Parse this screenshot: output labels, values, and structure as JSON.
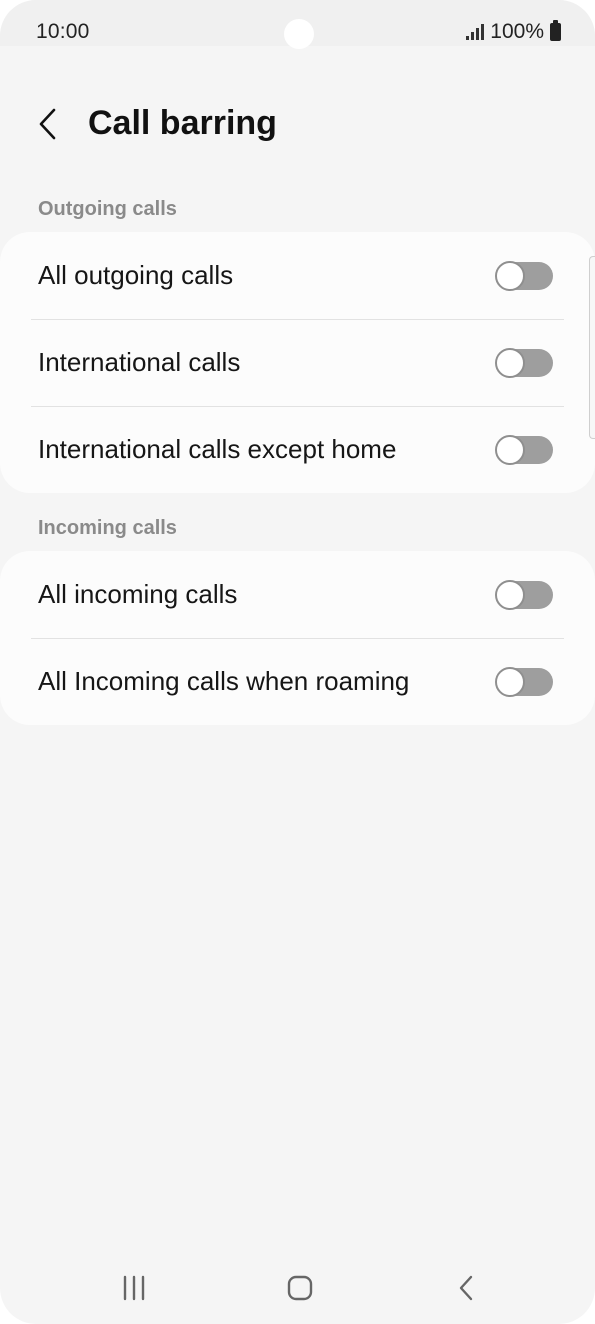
{
  "status_bar": {
    "time": "10:00",
    "battery": "100%",
    "icons": [
      "signal-icon",
      "battery-icon"
    ]
  },
  "header": {
    "title": "Call barring",
    "back_icon": "chevron-left-icon"
  },
  "sections": [
    {
      "title": "Outgoing calls",
      "items": [
        {
          "label": "All outgoing calls",
          "enabled": false
        },
        {
          "label": "International calls",
          "enabled": false
        },
        {
          "label": "International calls except home",
          "enabled": false
        }
      ]
    },
    {
      "title": "Incoming calls",
      "items": [
        {
          "label": "All incoming calls",
          "enabled": false
        },
        {
          "label": "All Incoming calls when roaming",
          "enabled": false
        }
      ]
    }
  ],
  "nav_bar": {
    "icons": [
      "recent-apps-icon",
      "home-icon",
      "back-icon"
    ]
  },
  "colors": {
    "background": "#f5f5f5",
    "card": "#fcfcfc",
    "section_header": "#8a8a8a",
    "toggle_off_track": "#9e9e9e"
  }
}
